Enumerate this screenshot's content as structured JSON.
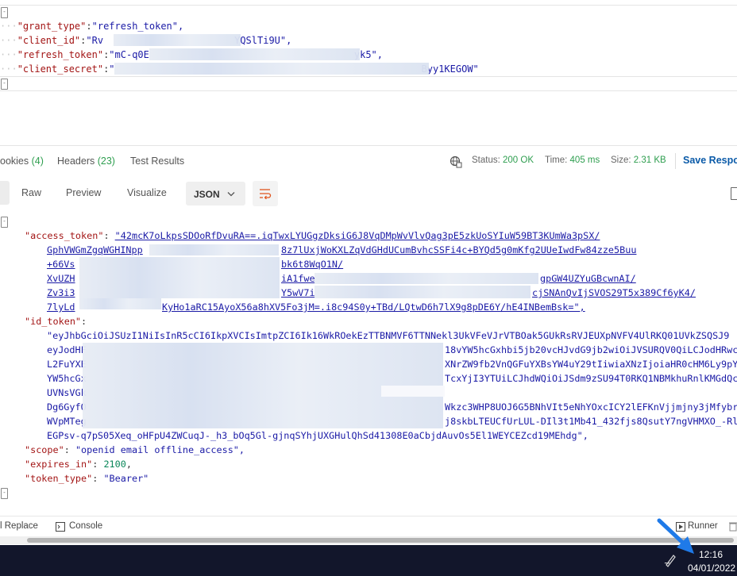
{
  "request_body": {
    "lines": [
      {
        "key": "\"grant_type\"",
        "value": "\"refresh_token\","
      },
      {
        "key": "\"client_id\"",
        "value": "\"Rv",
        "value_tail": "YQSlTi9U\","
      },
      {
        "key": "\"refresh_token\"",
        "value": "\"mC-q0E",
        "value_tail": "yk5\","
      },
      {
        "key": "\"client_secret\"",
        "value": "\"",
        "value_tail": "Byy1KEGOW\""
      }
    ]
  },
  "response_tabs": {
    "cookies_label": "ookies",
    "cookies_count": "(4)",
    "headers_label": "Headers",
    "headers_count": "(23)",
    "test_results_label": "Test Results"
  },
  "response_stats": {
    "status_label": "Status:",
    "status_value": "200 OK",
    "time_label": "Time:",
    "time_value": "405 ms",
    "size_label": "Size:",
    "size_value": "2.31 KB",
    "save_label": "Save Respo"
  },
  "format_bar": {
    "raw": "Raw",
    "preview": "Preview",
    "visualize": "Visualize",
    "format_select": "JSON"
  },
  "response_body": {
    "access_token_key": "\"access_token\"",
    "access_token_lines": [
      "\"42mcK7oLkpsSDOoRfDvuRA==.iqTwxLYUGgzDksiG6J8VqDMpWvVlvQag3pE5zkUoSYIuW59BT3KUmWa3pSX/",
      "GphVWGmZgqWGHINpp",
      "8z7lUxjWoKXLZqVdGHdUCumBvhcSSFi4c+BYQd5g0mKfg2UUeIwdFw84zze5Buu",
      "+66Vs",
      "bk6t8WqO1N/",
      "XvUZH",
      "iA1fwe",
      "gpGW4UZYuGBcwnAI/",
      "Zv3i3",
      "Y5wV7i",
      "cjSNAnQvIjSVOS29T5x389Cf6yK4/",
      "7lyLd",
      "KyHo1aRC15AyoX56a8hXV5Fo3jM=.i8c94S0y+TBd/LQtwD6h7lX9g8pDE6Y/hE4INBemBsk=\","
    ],
    "id_token_key": "\"id_token\"",
    "id_token_lines": [
      "\"eyJhbGciOiJSUzI1NiIsInR5cCI6IkpXVCIsImtpZCI6Ik16WkROekEzTTBNMVF6TTNNekl3UkVFeVJrVTBOak5GUkRsRVJEUXpNVFV4UlRKQ01UVkZSQSJ9",
      "eyJodHF",
      "18vYW5hcGxhbi5jb20vcHJvdG9jb2wiOiJVSURQV0QiLCJodHRwc",
      "L2FuYXE",
      "XNrZW9fb2VnQGFuYXBsYW4uY29tIiwiaXNzIjoiaHR0cHM6Ly9pY",
      "YW5hcGx",
      "TcxYjI3YTUiLCJhdWQiOiJSdm9zSU94T0RKQ1NBMkhuRnlKMGdQc",
      "UVNsVGk",
      "Dg6GyfO",
      "Wkzc3WHP8UOJ6G5BNhVIt5eNhYOxcICY2lEFKnVjjmjny3jMfybr",
      "WVpMTeg",
      "j8skbLTEUCfUrLUL-DIl3t1Mb41_432fjs8QsutY7ngVHMXO_-Rl",
      "EGPsv-q7pS05Xeq_oHFpU4ZWCuqJ-_h3_bOq5Gl-gjnqSYhjUXGHulQhSd41308E0aCbjdAuvOs5El1WEYCEZcd19MEhdg\","
    ],
    "scope_key": "\"scope\"",
    "scope_value": "\"openid email offline_access\",",
    "expires_key": "\"expires_in\"",
    "expires_value": "2100",
    "token_type_key": "\"token_type\"",
    "token_type_value": "\"Bearer\""
  },
  "status_bar": {
    "replace": "l Replace",
    "console": "Console",
    "runner": "Runner"
  },
  "taskbar": {
    "time": "12:16",
    "date": "04/01/2022"
  }
}
